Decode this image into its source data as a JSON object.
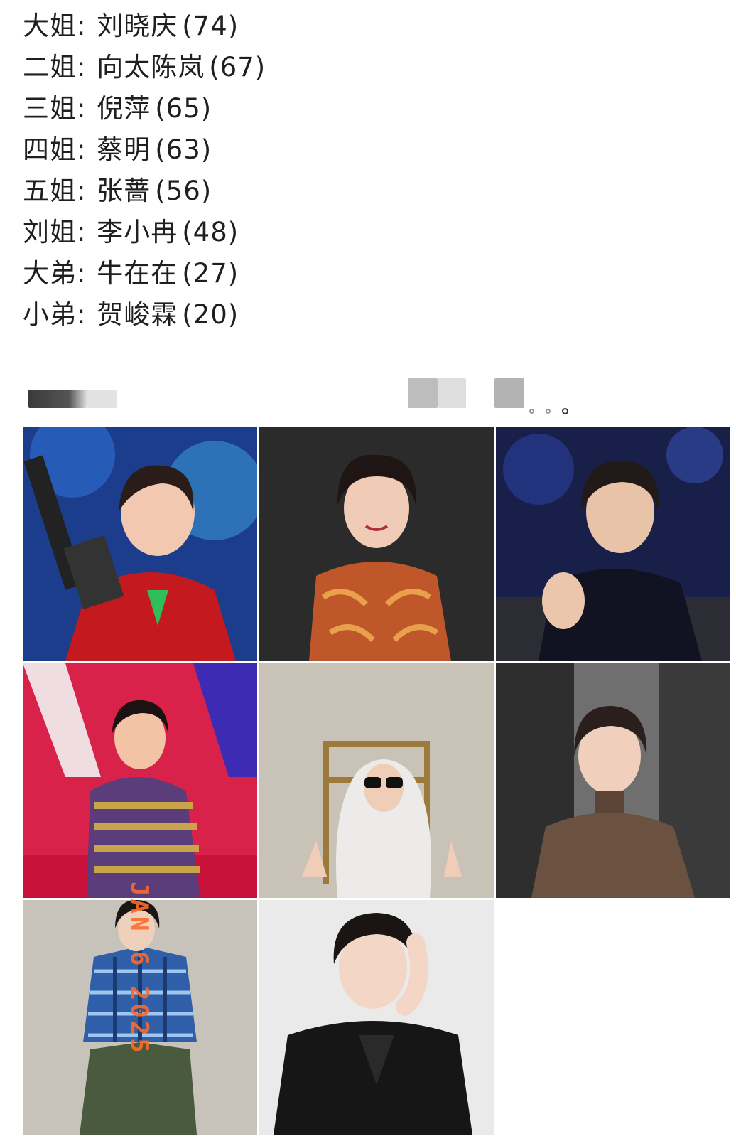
{
  "list": [
    {
      "role": "大姐",
      "name": "刘晓庆",
      "age": "(74)"
    },
    {
      "role": "二姐",
      "name": "向太陈岚",
      "age": "(67)"
    },
    {
      "role": "三姐",
      "name": "倪萍",
      "age": "(65)"
    },
    {
      "role": "四姐",
      "name": "蔡明",
      "age": "(63)"
    },
    {
      "role": "五姐",
      "name": "张蔷",
      "age": "(56)"
    },
    {
      "role": "刘姐",
      "name": "李小冉",
      "age": "(48)"
    },
    {
      "role": "大弟",
      "name": "牛在在",
      "age": "(27)"
    },
    {
      "role": "小弟",
      "name": "贺峻霖",
      "age": "(20)"
    }
  ],
  "separator": ":",
  "photo_stamp": "JAN 6 2025",
  "photos": [
    {
      "subject": "刘晓庆"
    },
    {
      "subject": "向太陈岚"
    },
    {
      "subject": "倪萍"
    },
    {
      "subject": "蔡明"
    },
    {
      "subject": "张蔷"
    },
    {
      "subject": "李小冉"
    },
    {
      "subject": "牛在在"
    },
    {
      "subject": "贺峻霖"
    }
  ],
  "colors": {
    "text": "#1f1f1f",
    "stamp": "#ff6a2a"
  }
}
